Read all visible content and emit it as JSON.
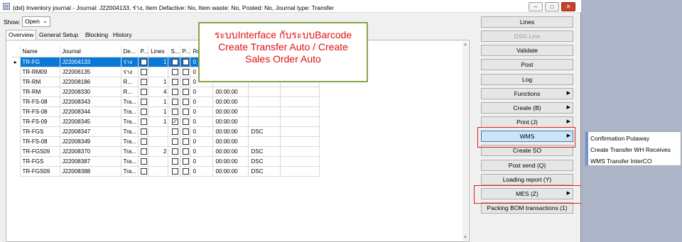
{
  "window": {
    "title": "(dsl) Inventory journal - Journal: J22004133, ร่าง, Item Defactive: No, Item waste: No, Posted: No, Journal type: Transfer",
    "minimize": "–",
    "maximize": "□",
    "close": "✕"
  },
  "filter": {
    "show_label": "Show:",
    "show_value": "Open",
    "chevron": "⌄"
  },
  "tabs": [
    "Overview",
    "General",
    "Setup",
    "Blocking",
    "History"
  ],
  "grid": {
    "columns": [
      "Name",
      "Journal",
      "De...",
      "P...",
      "Lines",
      "S...",
      "P...",
      "Ro",
      "",
      "",
      ""
    ],
    "pointer": "▸",
    "rows": [
      {
        "name": "TR-FG",
        "journal": "J22004133",
        "desc": "ร่าง",
        "p1": false,
        "lines": "1",
        "s": false,
        "p2": false,
        "ro": "0",
        "time": "",
        "code": "",
        "selected": true
      },
      {
        "name": "TR-RM09",
        "journal": "J22006135",
        "desc": "ร่าง",
        "p1": false,
        "lines": "",
        "s": false,
        "p2": false,
        "ro": "0",
        "time": "",
        "code": "",
        "selected": false
      },
      {
        "name": "TR-RM",
        "journal": "J22008186",
        "desc": "R...",
        "p1": false,
        "lines": "1",
        "s": false,
        "p2": false,
        "ro": "0",
        "time": "",
        "code": "",
        "selected": false
      },
      {
        "name": "TR-RM",
        "journal": "J22008330",
        "desc": "R...",
        "p1": false,
        "lines": "4",
        "s": false,
        "p2": false,
        "ro": "0",
        "time": "00:00:00",
        "code": "",
        "selected": false
      },
      {
        "name": "TR-FS-08",
        "journal": "J22008343",
        "desc": "Tra...",
        "p1": false,
        "lines": "1",
        "s": false,
        "p2": false,
        "ro": "0",
        "time": "00:00:00",
        "code": "",
        "selected": false
      },
      {
        "name": "TR-FS-08",
        "journal": "J22008344",
        "desc": "Tra...",
        "p1": false,
        "lines": "1",
        "s": false,
        "p2": false,
        "ro": "0",
        "time": "00:00:00",
        "code": "",
        "selected": false
      },
      {
        "name": "TR-FS-09",
        "journal": "J22008345",
        "desc": "Tra...",
        "p1": false,
        "lines": "1",
        "s": true,
        "p2": false,
        "ro": "0",
        "time": "00:00:00",
        "code": "",
        "selected": false
      },
      {
        "name": "TR-FGS",
        "journal": "J22008347",
        "desc": "Tra...",
        "p1": false,
        "lines": "",
        "s": false,
        "p2": false,
        "ro": "0",
        "time": "00:00:00",
        "code": "DSC",
        "selected": false
      },
      {
        "name": "TR-FS-08",
        "journal": "J22008349",
        "desc": "Tra...",
        "p1": false,
        "lines": "",
        "s": false,
        "p2": false,
        "ro": "0",
        "time": "00:00:00",
        "code": "",
        "selected": false
      },
      {
        "name": "TR-FGS09",
        "journal": "J22008370",
        "desc": "Tra...",
        "p1": false,
        "lines": "2",
        "s": false,
        "p2": false,
        "ro": "0",
        "time": "00:00:00",
        "code": "DSC",
        "selected": false
      },
      {
        "name": "TR-FGS",
        "journal": "J22008387",
        "desc": "Tra...",
        "p1": false,
        "lines": "",
        "s": false,
        "p2": false,
        "ro": "0",
        "time": "00:00:00",
        "code": "DSC",
        "selected": false
      },
      {
        "name": "TR-FGS09",
        "journal": "J22008388",
        "desc": "Tra...",
        "p1": false,
        "lines": "",
        "s": false,
        "p2": false,
        "ro": "0",
        "time": "00:00:00",
        "code": "DSC",
        "selected": false
      }
    ]
  },
  "callout": {
    "line1": "ระบบInterface กับระบบBarcode",
    "line2": "Create Transfer Auto / Create",
    "line3": "Sales Order Auto",
    "color": "#e01010",
    "border_color": "#84a64a"
  },
  "buttons": [
    {
      "label": "Lines",
      "has_menu": false,
      "disabled": false,
      "highlighted": false
    },
    {
      "label": "DSG Line",
      "has_menu": false,
      "disabled": true,
      "highlighted": false
    },
    {
      "label": "Validate",
      "has_menu": false,
      "disabled": false,
      "highlighted": false
    },
    {
      "label": "Post",
      "has_menu": false,
      "disabled": false,
      "highlighted": false
    },
    {
      "label": "Log",
      "has_menu": false,
      "disabled": false,
      "highlighted": false
    },
    {
      "label": "Functions",
      "has_menu": true,
      "disabled": false,
      "highlighted": false
    },
    {
      "label": "Create (B)",
      "has_menu": true,
      "disabled": false,
      "highlighted": false
    },
    {
      "label": "Print (J)",
      "has_menu": true,
      "disabled": false,
      "highlighted": false
    },
    {
      "label": "WMS",
      "has_menu": true,
      "disabled": false,
      "highlighted": true
    },
    {
      "label": "Create SO",
      "has_menu": false,
      "disabled": false,
      "highlighted": false
    },
    {
      "label": "Post send (Q)",
      "has_menu": false,
      "disabled": false,
      "highlighted": false
    },
    {
      "label": "Loading report (Y)",
      "has_menu": false,
      "disabled": false,
      "highlighted": false
    },
    {
      "label": "MES (Z)",
      "has_menu": true,
      "disabled": false,
      "highlighted": false
    },
    {
      "label": "Packing BOM transactions (1)",
      "has_menu": false,
      "disabled": false,
      "highlighted": false
    }
  ],
  "menu_arrow": "▶",
  "wms_submenu": [
    "Confirmation Putaway",
    "Create Transfer WH Receives",
    "WMS Transfer InterCO"
  ],
  "accent_colors": {
    "selection": "#0a78d7",
    "annotation_red": "#e02020",
    "submenu_strip": "#6f93d8"
  }
}
